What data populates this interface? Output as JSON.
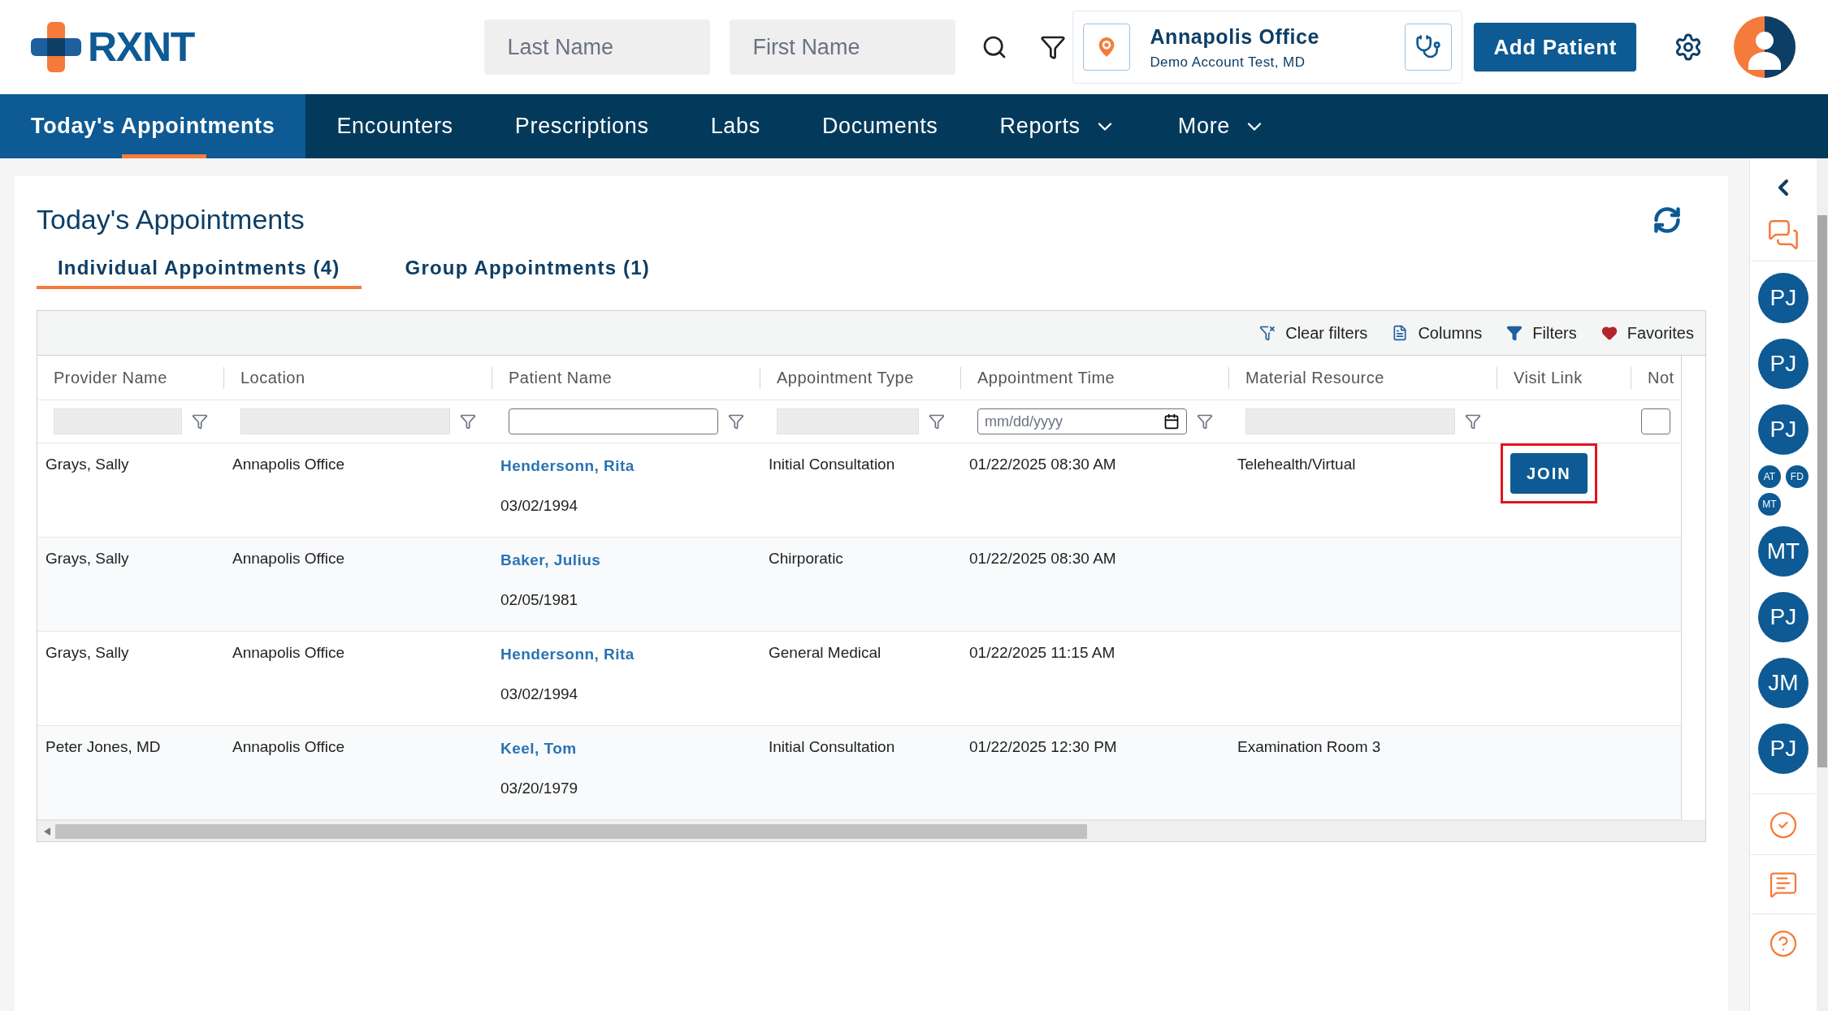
{
  "header": {
    "logo": "RXNT",
    "search_fields": [
      {
        "placeholder": "Last Name"
      },
      {
        "placeholder": "First Name"
      }
    ],
    "location": {
      "name": "Annapolis Office",
      "account": "Demo Account Test, MD"
    },
    "add_button": "Add Patient"
  },
  "nav": [
    {
      "label": "Today's Appointments",
      "selected": true,
      "dropdown": false
    },
    {
      "label": "Encounters",
      "selected": false,
      "dropdown": false
    },
    {
      "label": "Prescriptions",
      "selected": false,
      "dropdown": false
    },
    {
      "label": "Labs",
      "selected": false,
      "dropdown": false
    },
    {
      "label": "Documents",
      "selected": false,
      "dropdown": false
    },
    {
      "label": "Reports",
      "selected": false,
      "dropdown": true
    },
    {
      "label": "More",
      "selected": false,
      "dropdown": true
    }
  ],
  "page": {
    "title": "Today's Appointments"
  },
  "tabs": [
    {
      "label": "Individual Appointments (4)",
      "selected": true
    },
    {
      "label": "Group Appointments (1)",
      "selected": false
    }
  ],
  "toolbar": [
    {
      "kind": "clear",
      "label": "Clear filters"
    },
    {
      "kind": "columns",
      "label": "Columns"
    },
    {
      "kind": "filters",
      "label": "Filters"
    },
    {
      "kind": "favorites",
      "label": "Favorites"
    }
  ],
  "table": {
    "columns": [
      {
        "label": "Provider Name",
        "kind": "disabled"
      },
      {
        "label": "Location",
        "kind": "disabled"
      },
      {
        "label": "Patient Name",
        "kind": "text"
      },
      {
        "label": "Appointment Type",
        "kind": "disabled"
      },
      {
        "label": "Appointment Time",
        "kind": "date",
        "placeholder": "mm/dd/yyyy"
      },
      {
        "label": "Material Resource",
        "kind": "disabled"
      },
      {
        "label": "Visit Link",
        "kind": "none"
      },
      {
        "label": "Not",
        "kind": "partial"
      }
    ],
    "rows": [
      {
        "provider": "Grays, Sally",
        "location": "Annapolis Office",
        "patient": "Hendersonn, Rita",
        "dob": "03/02/1994",
        "type": "Initial Consultation",
        "time": "01/22/2025 08:30 AM",
        "resource": "Telehealth/Virtual",
        "visit_link": {
          "label": "JOIN",
          "highlighted": true
        }
      },
      {
        "provider": "Grays, Sally",
        "location": "Annapolis Office",
        "patient": "Baker, Julius",
        "dob": "02/05/1981",
        "type": "Chirporatic",
        "time": "01/22/2025 08:30 AM"
      },
      {
        "provider": "Grays, Sally",
        "location": "Annapolis Office",
        "patient": "Hendersonn, Rita",
        "dob": "03/02/1994",
        "type": "General Medical",
        "time": "01/22/2025 11:15 AM"
      },
      {
        "provider": "Peter Jones, MD",
        "location": "Annapolis Office",
        "patient": "Keel, Tom",
        "dob": "03/20/1979",
        "type": "Initial Consultation",
        "time": "01/22/2025 12:30 PM",
        "resource": "Examination Room 3"
      }
    ]
  },
  "sidebar": {
    "avatars": [
      {
        "kind": "large",
        "initials": [
          "PJ"
        ]
      },
      {
        "kind": "large",
        "initials": [
          "PJ"
        ]
      },
      {
        "kind": "large",
        "initials": [
          "PJ"
        ]
      },
      {
        "kind": "group",
        "initials": [
          "AT",
          "FD",
          "MT"
        ]
      },
      {
        "kind": "large",
        "initials": [
          "MT"
        ]
      },
      {
        "kind": "large",
        "initials": [
          "PJ"
        ]
      },
      {
        "kind": "large",
        "initials": [
          "JM"
        ]
      },
      {
        "kind": "large",
        "initials": [
          "PJ"
        ]
      }
    ]
  }
}
